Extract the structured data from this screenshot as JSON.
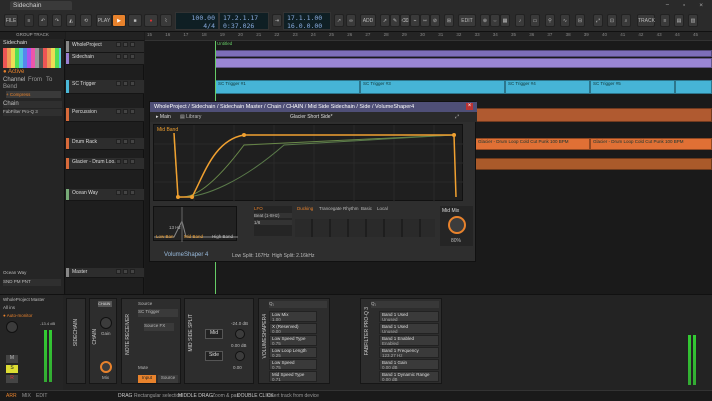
{
  "window": {
    "tab": "Sidechain Breakdown Video*"
  },
  "toolbar": {
    "file": "FILE",
    "play": "PLAY",
    "tempo": "100.00",
    "sig": "4/4",
    "pos1": "17.2.1.17",
    "pos2": "0:37.026",
    "loop1": "17.1.1.00",
    "loop2": "16.0.0.00",
    "add": "ADD",
    "edit": "EDIT",
    "track": "TRACK"
  },
  "inspector": {
    "title": "GROUP TRACK",
    "name": "Sidechain",
    "active": "Active",
    "channel": "Channel",
    "from": "From",
    "to": "To",
    "bend": "Bend",
    "comp": "+ Compress",
    "chain": "Chain",
    "fx": "FabFilter Pro-Q 3",
    "ocean": "Ocean Way",
    "wp_master": "WholeProject Master",
    "all_ins": "All ins",
    "auto": "Auto-monitor",
    "val1": "-13.4 dB",
    "mute": "M",
    "solo": "S",
    "rec": "R",
    "snd": "SND",
    "pm": "PM",
    "pnt": "PNT"
  },
  "tracks": [
    {
      "name": "WholeProject",
      "color": "#888"
    },
    {
      "name": "Sidechain",
      "color": "#9a7fd0"
    },
    {
      "name": "SC Trigger",
      "color": "#4bb8d8"
    },
    {
      "name": "Percussion",
      "color": "#d86a3a"
    },
    {
      "name": "Drum Rack",
      "color": "#d86a3a"
    },
    {
      "name": "Glacier - Drum Loo...",
      "color": "#d86a3a"
    },
    {
      "name": "Ocean Way",
      "color": "#7a7"
    },
    {
      "name": "Master",
      "color": "#888"
    }
  ],
  "ruler": [
    "15",
    "16",
    "17",
    "18",
    "19",
    "20",
    "21",
    "22",
    "23",
    "24",
    "25",
    "26",
    "27",
    "28",
    "29",
    "30",
    "31",
    "32",
    "33",
    "34",
    "35",
    "36",
    "37",
    "38",
    "39",
    "40",
    "41",
    "42",
    "43",
    "44",
    "45"
  ],
  "clips": {
    "sc": "SC Trigger",
    "sc1": "SC Trigger #1",
    "sc2": "SC Trigger #2",
    "sc3": "SC Trigger #3",
    "sc4": "SC Trigger #4",
    "sc5": "SC Trigger #5",
    "glacier": "Glacier - Drum Loop Cold Cut Punk 100 BPM",
    "glacier2": "Glacier - Drum Loop Cold Cut Punk 100 BPM",
    "cue": "Untitled"
  },
  "plugin": {
    "title": "WholeProject / Sidechain / Sidechain Master / Chain / CHAIN / Mid Side Sidechain / Side / VolumeShaper4",
    "main": "Main",
    "library": "Library",
    "preset": "Glacier Short Side*",
    "band": "Mid Band",
    "low": "Low Ban",
    "mid": "Mid Band",
    "high": "High Band",
    "lfo": "LFO",
    "beat": "Beat (1-8Hz)",
    "div": "1/8",
    "freq": "13 Hz",
    "tabs": [
      "Ducking",
      "Trancegate",
      "Rhythm",
      "Basic",
      "Local"
    ],
    "mix": "Mid Mix",
    "mixval": "80%",
    "brand": "VolumeShaper 4",
    "lowsplit": "Low Split: 167Hz",
    "highsplit": "High Split: 2.16kHz"
  },
  "devices": {
    "sidechain": "SIDECHAIN",
    "chain": "CHAIN",
    "gain": "Gain",
    "mix": "Mix",
    "source": "Source",
    "sctrig": "SC Trigger",
    "srcfx": "Source FX",
    "mute": "Mute",
    "input": "Input",
    "sourcebtn": "Source",
    "notereceiver": "NOTE RECEIVER",
    "midside": "MID SIDE SPLIT",
    "mid": "Mid",
    "side": "Side",
    "db1": "-24.0 dB",
    "db2": "0.00 dB",
    "db3": "0.00",
    "eq1": "Q₁",
    "eq2": "Q₁",
    "params1": [
      {
        "n": "Low Mix",
        "v": "1.00"
      },
      {
        "n": "X (Reserved)",
        "v": "0.00"
      },
      {
        "n": "Low Speed Type",
        "v": "0.75"
      },
      {
        "n": "Low Loop Length",
        "v": "0.25"
      },
      {
        "n": "Low Speed",
        "v": "0.75"
      },
      {
        "n": "Mid Speed Type",
        "v": "0.71"
      }
    ],
    "params2": [
      {
        "n": "Band 1 Used",
        "v": "Unused"
      },
      {
        "n": "Band 1 Used",
        "v": "Unused"
      },
      {
        "n": "Band 1 Enabled",
        "v": "Enabled"
      },
      {
        "n": "Band 1 Frequency",
        "v": "123.27 Hz"
      },
      {
        "n": "Band 1 Gain",
        "v": "0.00 dB"
      },
      {
        "n": "Band 1 Dynamic Range",
        "v": "0.00 dB"
      }
    ],
    "vs4": "VOLUMESHAPER4",
    "ffpro": "FABFILTER PRO-Q 3"
  },
  "status": {
    "arr": "ARR",
    "mix": "MIX",
    "edit": "EDIT",
    "drag": "DRAG",
    "dragdesc": "Rectangular selection",
    "middrag": "MIDDLE DRAG",
    "middesc": "Zoom & pan",
    "dbl": "DOUBLE CLICK",
    "dbldesc": "Insert track from device"
  }
}
